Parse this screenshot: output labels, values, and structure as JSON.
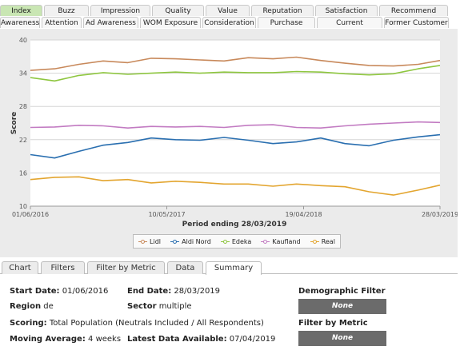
{
  "metric_tabs_row1": [
    {
      "label": "Index",
      "active": true
    },
    {
      "label": "Buzz",
      "active": false
    },
    {
      "label": "Impression",
      "active": false
    },
    {
      "label": "Quality",
      "active": false
    },
    {
      "label": "Value",
      "active": false
    },
    {
      "label": "Reputation",
      "active": false
    },
    {
      "label": "Satisfaction",
      "active": false
    },
    {
      "label": "Recommend",
      "active": false
    }
  ],
  "metric_tabs_row2": [
    {
      "label": "Awareness"
    },
    {
      "label": "Attention"
    },
    {
      "label": "Ad Awareness"
    },
    {
      "label": "WOM Exposure"
    },
    {
      "label": "Consideration"
    },
    {
      "label": "Purchase Intent"
    },
    {
      "label": "Current Customer"
    },
    {
      "label": "Former Customer"
    }
  ],
  "chart_data": {
    "type": "line",
    "xlabel": "Period ending 28/03/2019",
    "ylabel": "Score",
    "ylim": [
      10,
      40
    ],
    "yticks": [
      10,
      16,
      22,
      28,
      34,
      40
    ],
    "xlim": [
      "01/06/2016",
      "28/03/2019"
    ],
    "xtick_labels": [
      "01/06/2016",
      "10/05/2017",
      "19/04/2018",
      "28/03/2019"
    ],
    "x_dates": [
      "01/06/2016",
      "01/08/2016",
      "01/10/2016",
      "01/12/2016",
      "01/02/2017",
      "01/04/2017",
      "01/06/2017",
      "01/08/2017",
      "01/10/2017",
      "01/12/2017",
      "01/02/2018",
      "01/04/2018",
      "01/06/2018",
      "01/08/2018",
      "01/10/2018",
      "01/12/2018",
      "01/02/2019",
      "28/03/2019"
    ],
    "grid": true,
    "legend_position": "bottom",
    "series": [
      {
        "name": "Lidl",
        "color": "#c8895b",
        "values": [
          34.5,
          34.8,
          35.6,
          36.2,
          35.9,
          36.7,
          36.6,
          36.4,
          36.2,
          36.8,
          36.6,
          36.9,
          36.3,
          35.8,
          35.4,
          35.3,
          35.6,
          36.3
        ]
      },
      {
        "name": "Aldi Nord",
        "color": "#2a6fb0",
        "values": [
          19.3,
          18.7,
          19.9,
          21.0,
          21.5,
          22.3,
          22.0,
          21.9,
          22.4,
          21.9,
          21.3,
          21.6,
          22.3,
          21.3,
          20.9,
          21.9,
          22.5,
          22.9
        ]
      },
      {
        "name": "Edeka",
        "color": "#8ec63f",
        "values": [
          33.2,
          32.6,
          33.6,
          34.1,
          33.8,
          34.0,
          34.2,
          34.0,
          34.2,
          34.1,
          34.1,
          34.3,
          34.2,
          33.9,
          33.7,
          33.9,
          34.8,
          35.4
        ]
      },
      {
        "name": "Kaufland",
        "color": "#c27bc2",
        "values": [
          24.2,
          24.3,
          24.6,
          24.5,
          24.1,
          24.4,
          24.3,
          24.4,
          24.2,
          24.6,
          24.7,
          24.2,
          24.1,
          24.5,
          24.8,
          25.0,
          25.2,
          25.1
        ]
      },
      {
        "name": "Real",
        "color": "#e3a52f",
        "values": [
          14.8,
          15.2,
          15.3,
          14.6,
          14.8,
          14.2,
          14.5,
          14.3,
          14.0,
          14.0,
          13.6,
          14.0,
          13.7,
          13.5,
          12.6,
          12.0,
          12.9,
          13.8
        ]
      }
    ]
  },
  "bottom_tabs": [
    {
      "label": "Chart",
      "active": false
    },
    {
      "label": "Filters",
      "active": false
    },
    {
      "label": "Filter by Metric",
      "active": false
    },
    {
      "label": "Data",
      "active": false
    },
    {
      "label": "Summary",
      "active": true
    }
  ],
  "summary": {
    "start_date_label": "Start Date:",
    "start_date": "01/06/2016",
    "end_date_label": "End Date:",
    "end_date": "28/03/2019",
    "region_label": "Region",
    "region": "de",
    "sector_label": "Sector",
    "sector": "multiple",
    "scoring_label": "Scoring:",
    "scoring": "Total Population (Neutrals Included / All Respondents)",
    "moving_average_label": "Moving Average:",
    "moving_average": "4 weeks",
    "latest_data_label": "Latest Data Available:",
    "latest_data": "07/04/2019",
    "demographic_filter_label": "Demographic Filter",
    "demographic_filter_value": "None",
    "filter_by_metric_label": "Filter by Metric",
    "filter_by_metric_value": "None"
  }
}
